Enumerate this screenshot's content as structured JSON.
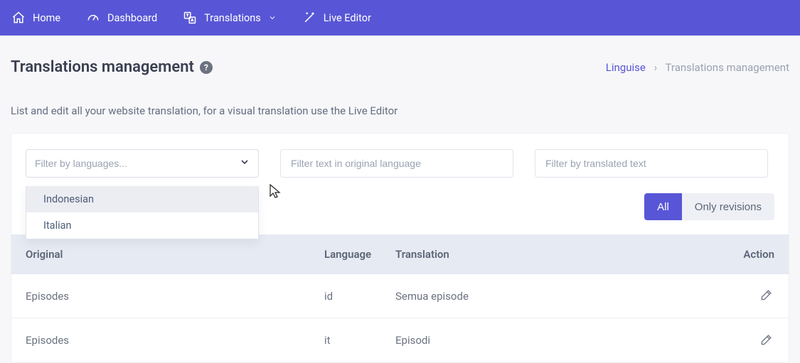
{
  "nav": {
    "home": "Home",
    "dashboard": "Dashboard",
    "translations": "Translations",
    "live_editor": "Live Editor"
  },
  "page": {
    "title": "Translations management",
    "subtitle": "List and edit all your website translation, for a visual translation use the Live Editor"
  },
  "breadcrumb": {
    "root": "Linguise",
    "current": "Translations management"
  },
  "filters": {
    "language_placeholder": "Filter by languages...",
    "original_placeholder": "Filter text in original language",
    "translated_placeholder": "Filter by translated text"
  },
  "language_options": [
    "Indonesian",
    "Italian"
  ],
  "toggle": {
    "all": "All",
    "revisions": "Only revisions"
  },
  "table": {
    "headers": {
      "original": "Original",
      "language": "Language",
      "translation": "Translation",
      "action": "Action"
    },
    "rows": [
      {
        "original": "Episodes",
        "language": "id",
        "translation": "Semua episode"
      },
      {
        "original": "Episodes",
        "language": "it",
        "translation": "Episodi"
      }
    ]
  }
}
